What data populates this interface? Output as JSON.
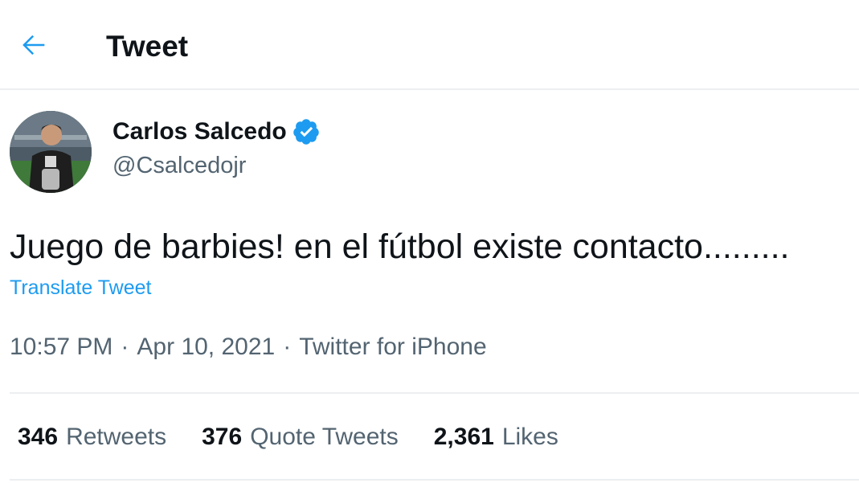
{
  "header": {
    "title": "Tweet",
    "back_icon": "arrow-left-icon"
  },
  "colors": {
    "accent": "#1d9bf0",
    "text_primary": "#0f1419",
    "text_secondary": "#536471",
    "divider": "#eceff1"
  },
  "author": {
    "display_name": "Carlos Salcedo",
    "handle": "@Csalcedojr",
    "verified_icon": "verified-badge-icon",
    "avatar_icon": "avatar"
  },
  "tweet": {
    "text": "Juego de barbies! en el fútbol existe contacto.........",
    "translate_label": "Translate Tweet",
    "time": "10:57 PM",
    "date": "Apr 10, 2021",
    "source": "Twitter for iPhone",
    "separator": "·"
  },
  "stats": [
    {
      "count": "346",
      "label": "Retweets"
    },
    {
      "count": "376",
      "label": "Quote Tweets"
    },
    {
      "count": "2,361",
      "label": "Likes"
    }
  ]
}
